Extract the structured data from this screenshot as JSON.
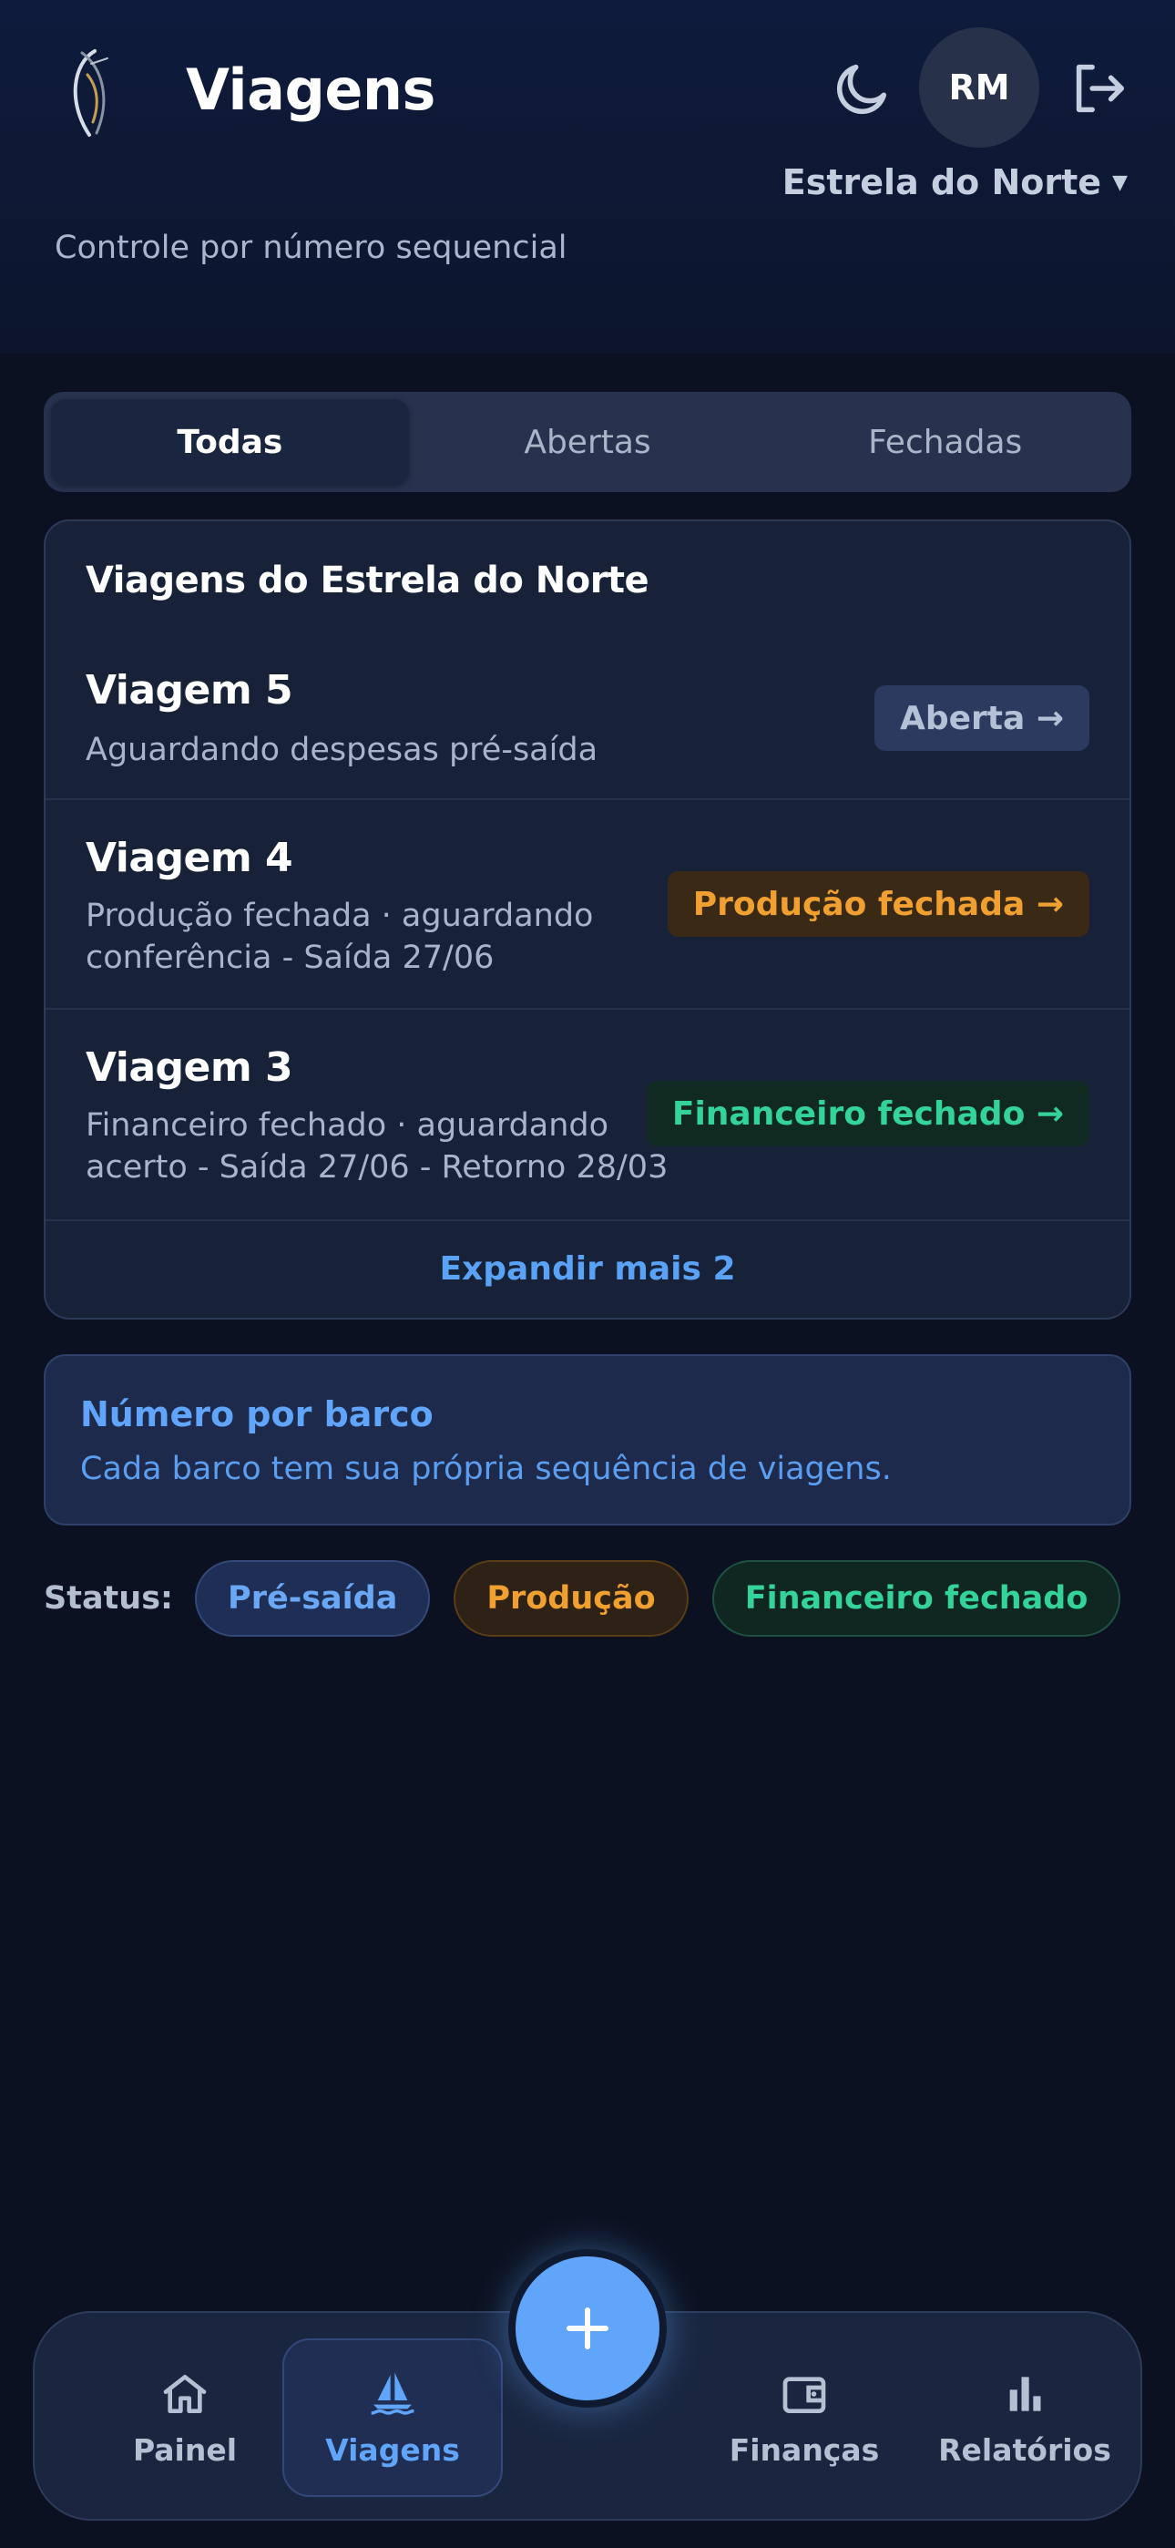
{
  "header": {
    "title": "Viagens",
    "subtitle": "Controle por número sequencial",
    "avatar_initials": "RM",
    "boat_name": "Estrela do Norte",
    "icons": {
      "logo": "marlin-logo-icon",
      "theme": "moon-icon",
      "logout": "logout-icon",
      "caret": "caret-down-icon"
    }
  },
  "tabs": [
    {
      "label": "Todas",
      "active": true
    },
    {
      "label": "Abertas",
      "active": false
    },
    {
      "label": "Fechadas",
      "active": false
    }
  ],
  "trips_card": {
    "title": "Viagens do Estrela do Norte",
    "trips": [
      {
        "name": "Viagem 5",
        "description": "Aguardando despesas pré-saída",
        "badge": "Aberta →",
        "badge_style": "open"
      },
      {
        "name": "Viagem 4",
        "description": "Produção fechada · aguardando conferência - Saída 27/06",
        "badge": "Produção fechada →",
        "badge_style": "prod"
      },
      {
        "name": "Viagem 3",
        "description": "Financeiro fechado · aguardando acerto - Saída 27/06 - Retorno 28/03",
        "badge": "Financeiro fechado →",
        "badge_style": "fin"
      }
    ],
    "expand_label": "Expandir mais 2"
  },
  "info": {
    "title": "Número por barco",
    "text": "Cada barco tem sua própria sequência de viagens."
  },
  "status_legend": {
    "label": "Status:",
    "items": [
      {
        "label": "Pré-saída",
        "style": "pre"
      },
      {
        "label": "Produção",
        "style": "prod"
      },
      {
        "label": "Financeiro fechado",
        "style": "fin"
      }
    ]
  },
  "bottom_nav": {
    "items": [
      {
        "label": "Painel",
        "icon": "home-icon",
        "active": false
      },
      {
        "label": "Viagens",
        "icon": "sailboat-icon",
        "active": true
      },
      {
        "label": "Finanças",
        "icon": "wallet-icon",
        "active": false
      },
      {
        "label": "Relatórios",
        "icon": "bar-chart-icon",
        "active": false
      }
    ],
    "fab_icon": "plus-icon"
  },
  "colors": {
    "background": "#0b1120",
    "accent": "#60a5fa",
    "production": "#f0a030",
    "financial": "#34d399"
  }
}
